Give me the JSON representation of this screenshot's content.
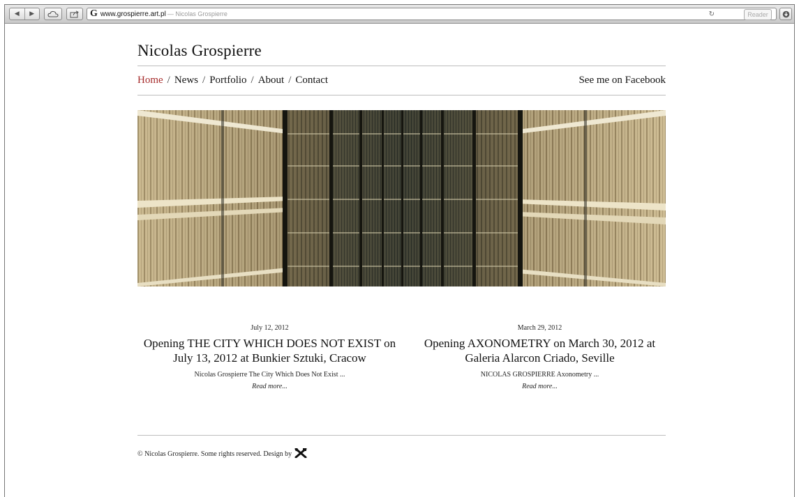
{
  "browser": {
    "url": "www.grospierre.art.pl",
    "tab_title": "— Nicolas Grospierre",
    "reader_label": "Reader",
    "back_icon": "◀",
    "forward_icon": "▶"
  },
  "site": {
    "title": "Nicolas Grospierre",
    "nav": [
      {
        "label": "Home",
        "active": true
      },
      {
        "label": "News"
      },
      {
        "label": "Portfolio"
      },
      {
        "label": "About"
      },
      {
        "label": "Contact"
      }
    ],
    "separator": "/",
    "facebook": "See me on Facebook",
    "banner_alt": "library corridor of bookshelves"
  },
  "posts": [
    {
      "date": "July 12, 2012",
      "title": "Opening THE CITY WHICH DOES NOT EXIST on July 13, 2012 at Bunkier Sztuki, Cracow",
      "excerpt": "Nicolas Grospierre The City Which Does Not Exist ...",
      "more": "Read more..."
    },
    {
      "date": "March 29, 2012",
      "title": "Opening AXONOMETRY on March 30, 2012 at Galeria Alarcon Criado, Seville",
      "excerpt": "NICOLAS GROSPIERRE  Axonometry ...",
      "more": "Read more..."
    }
  ],
  "footer": {
    "text": "© Nicolas Grospierre. Some rights reserved.  Design by",
    "logo_icon": "crossed-tools-icon"
  },
  "colors": {
    "accent": "#a52a2a",
    "text": "#111111",
    "rule": "#bdbdbd"
  }
}
